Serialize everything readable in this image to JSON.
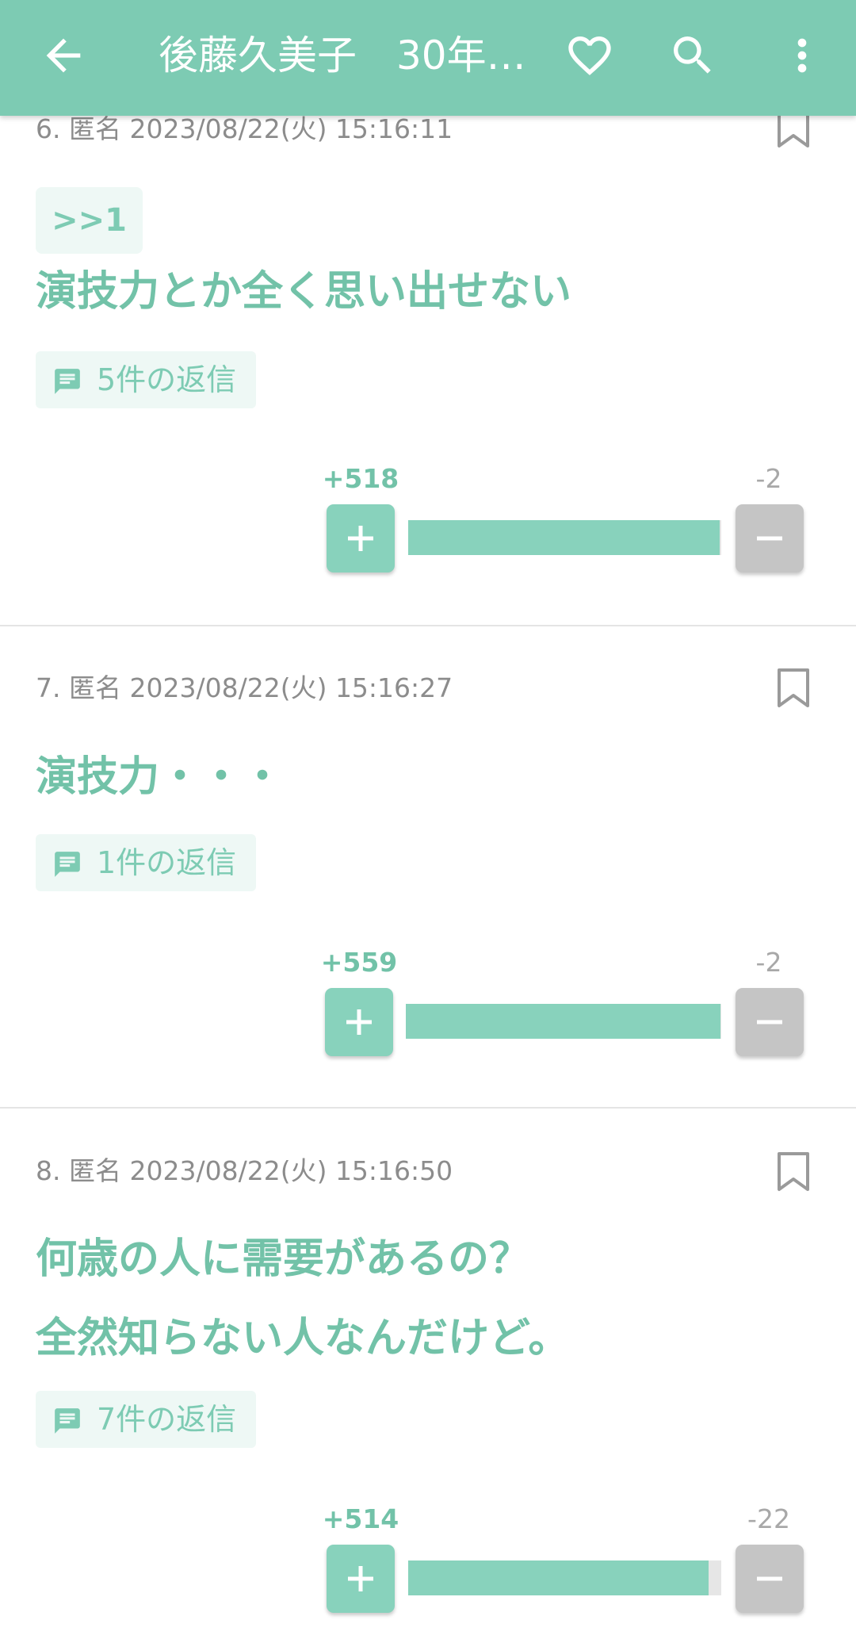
{
  "header": {
    "title": "後藤久美子　30年…",
    "icons": [
      "arrow-back-icon",
      "heart-outline-icon",
      "search-icon",
      "more-vert-icon"
    ],
    "colors": {
      "bar": "#7dcbb3",
      "text": "#ffffff"
    }
  },
  "colors": {
    "accent": "#72c2a8",
    "plus": "#88d2bc",
    "minus": "#c5c5c5",
    "reply_bg": "#eef8f5"
  },
  "comments": [
    {
      "number": "6.",
      "author": "匿名",
      "datetime": "2023/08/22(火) 15:16:11",
      "anchor": ">>1",
      "lines": [
        "演技力とか全く思い出せない"
      ],
      "replies": "5件の返信",
      "plus": "+518",
      "minus": "-2",
      "plus_ratio": 0.9962
    },
    {
      "number": "7.",
      "author": "匿名",
      "datetime": "2023/08/22(火) 15:16:27",
      "lines": [
        "演技力・・・"
      ],
      "replies": "1件の返信",
      "plus": "+559",
      "minus": "-2",
      "plus_ratio": 0.9964
    },
    {
      "number": "8.",
      "author": "匿名",
      "datetime": "2023/08/22(火) 15:16:50",
      "lines": [
        "何歳の人に需要があるの？",
        "全然知らない人なんだけど。"
      ],
      "replies": "7件の返信",
      "plus": "+514",
      "minus": "-22",
      "plus_ratio": 0.959
    }
  ]
}
